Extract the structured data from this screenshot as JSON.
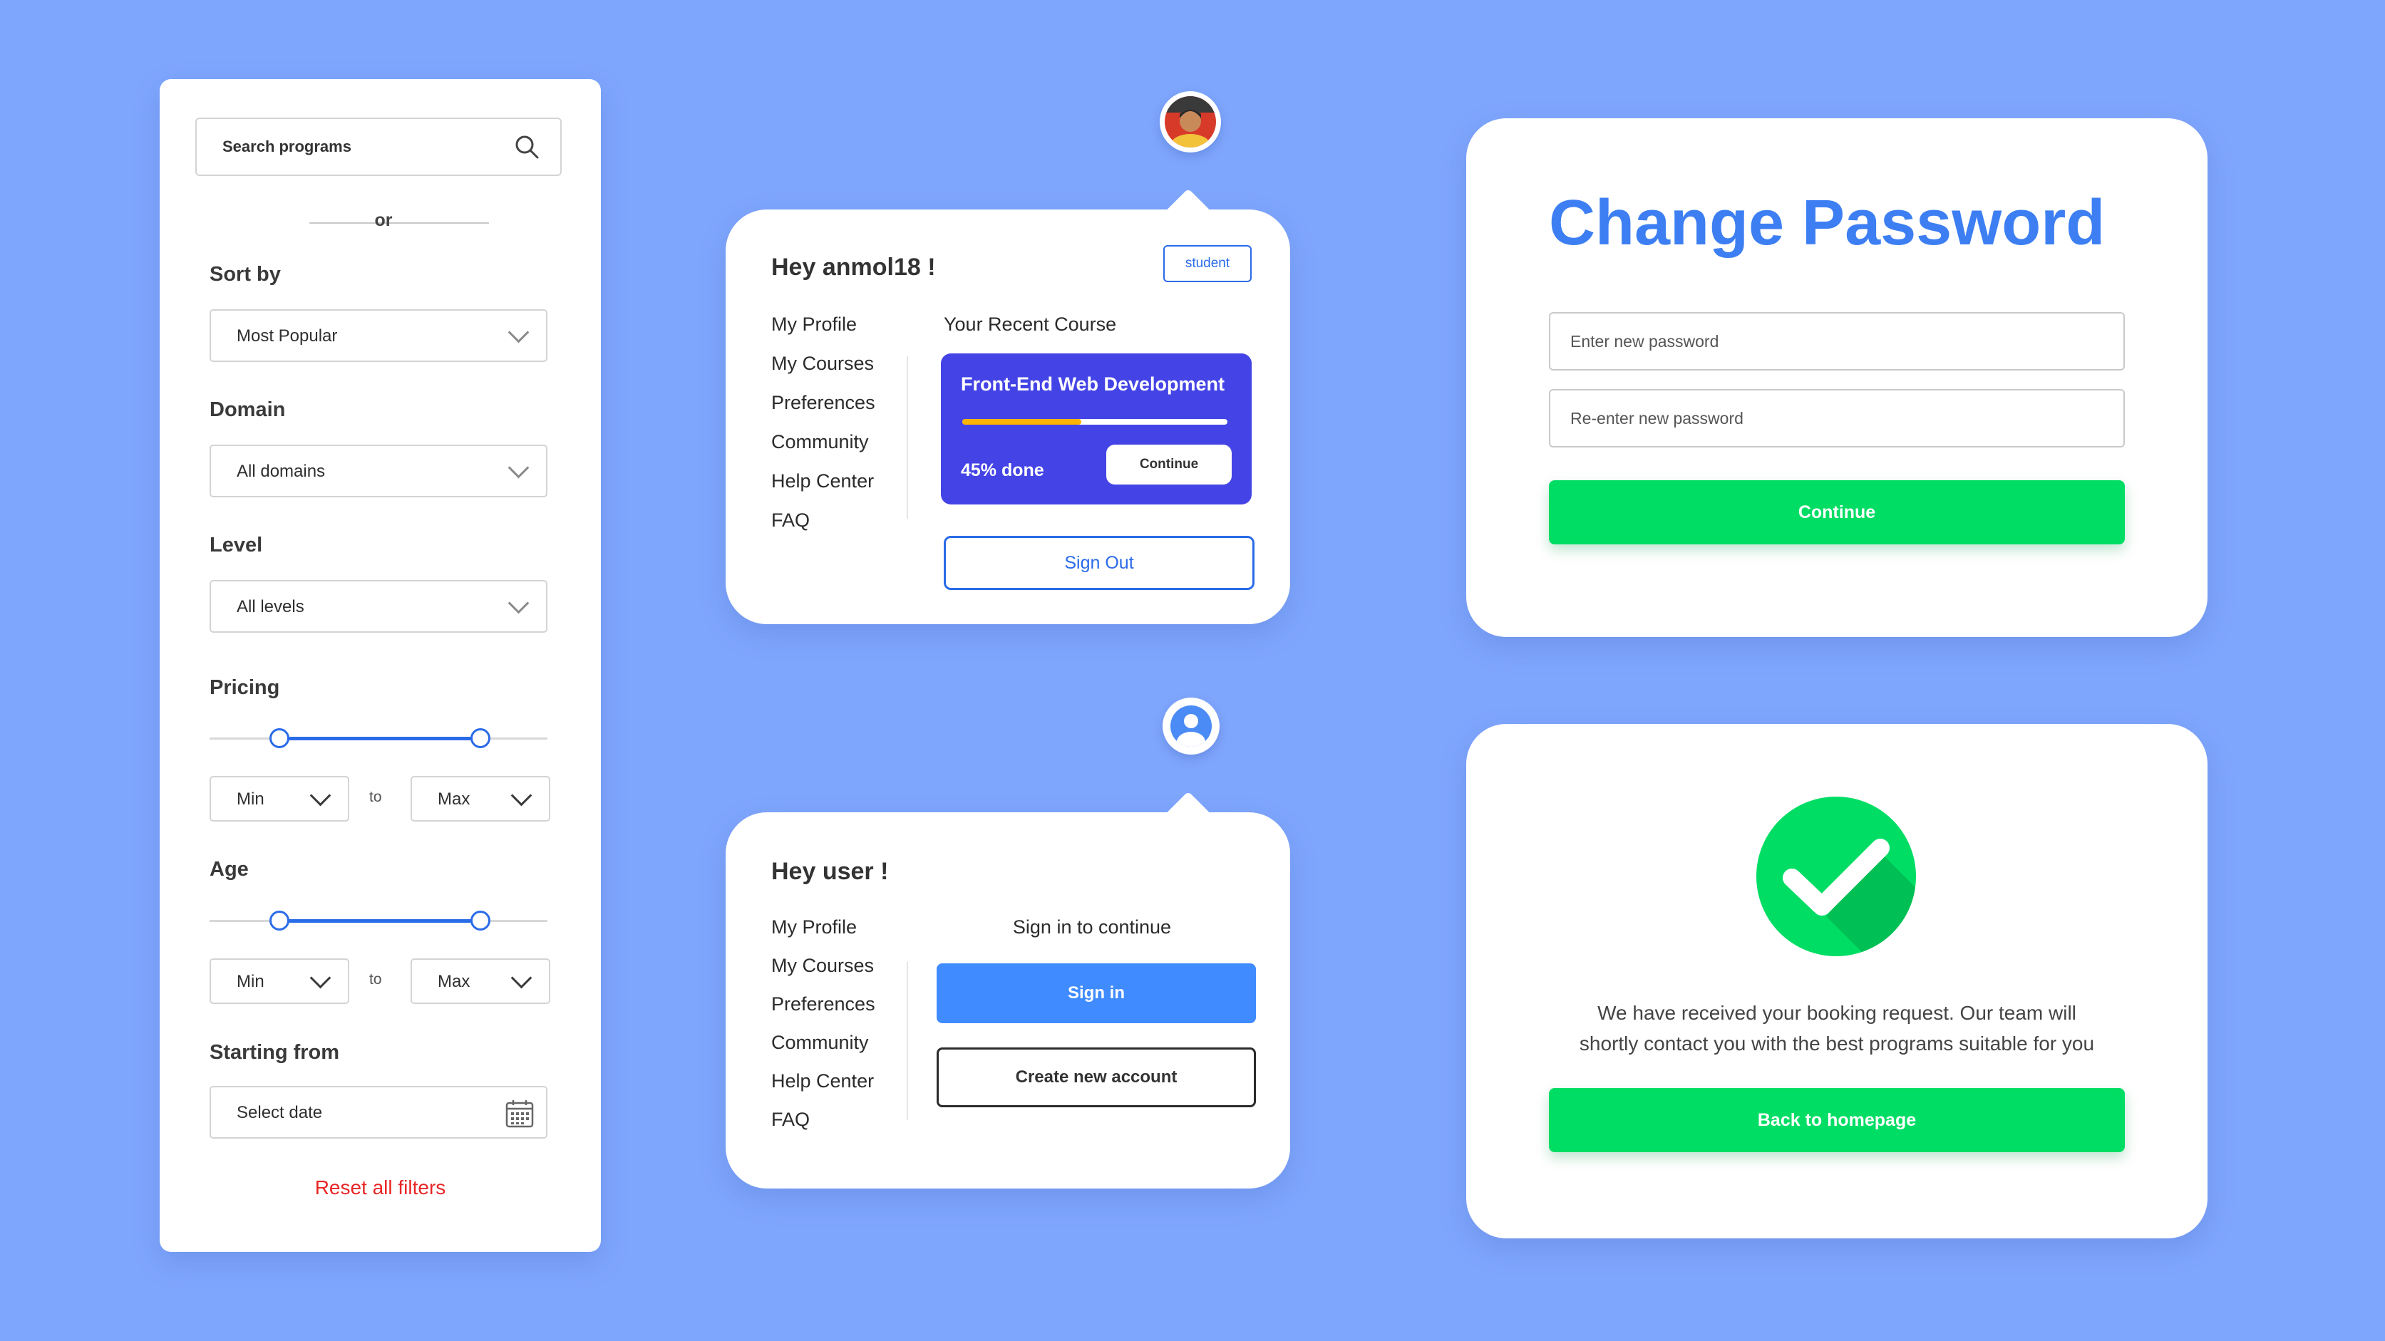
{
  "filter": {
    "search_placeholder": "Search programs",
    "or_label": "or",
    "sort": {
      "label": "Sort by",
      "value": "Most Popular"
    },
    "domain": {
      "label": "Domain",
      "value": "All domains"
    },
    "level": {
      "label": "Level",
      "value": "All levels"
    },
    "pricing": {
      "label": "Pricing",
      "min": "Min",
      "to": "to",
      "max": "Max",
      "range_low_pct": 20,
      "range_high_pct": 80
    },
    "age": {
      "label": "Age",
      "min": "Min",
      "to": "to",
      "max": "Max",
      "range_low_pct": 20,
      "range_high_pct": 80
    },
    "starting": {
      "label": "Starting from",
      "placeholder": "Select date"
    },
    "reset": "Reset all filters"
  },
  "profile_signed_in": {
    "greeting": "Hey anmol18 !",
    "role_badge": "student",
    "menu": [
      "My Profile",
      "My Courses",
      "Preferences",
      "Community",
      "Help Center",
      "FAQ"
    ],
    "recent_heading": "Your Recent Course",
    "course": {
      "title": "Front-End Web Development",
      "progress_pct": 45,
      "progress_text": "45% done",
      "continue": "Continue"
    },
    "sign_out": "Sign Out"
  },
  "profile_guest": {
    "greeting": "Hey user !",
    "menu": [
      "My Profile",
      "My Courses",
      "Preferences",
      "Community",
      "Help Center",
      "FAQ"
    ],
    "prompt": "Sign in to continue",
    "sign_in": "Sign in",
    "create_account": "Create new account"
  },
  "change_password": {
    "title": "Change Password",
    "new_password_placeholder": "Enter new password",
    "reenter_placeholder": "Re-enter new password",
    "continue": "Continue"
  },
  "booking": {
    "message_line1": "We have received your booking request. Our team will",
    "message_line2": "shortly contact you with the best programs suitable for you",
    "back_button": "Back to homepage"
  },
  "colors": {
    "background": "#7fa6fd",
    "accent_blue": "#2a6be8",
    "title_blue": "#3d7ff2",
    "course_card": "#4444e6",
    "progress": "#ffb300",
    "success_green": "#00dd64",
    "reset_red": "#e82626"
  }
}
